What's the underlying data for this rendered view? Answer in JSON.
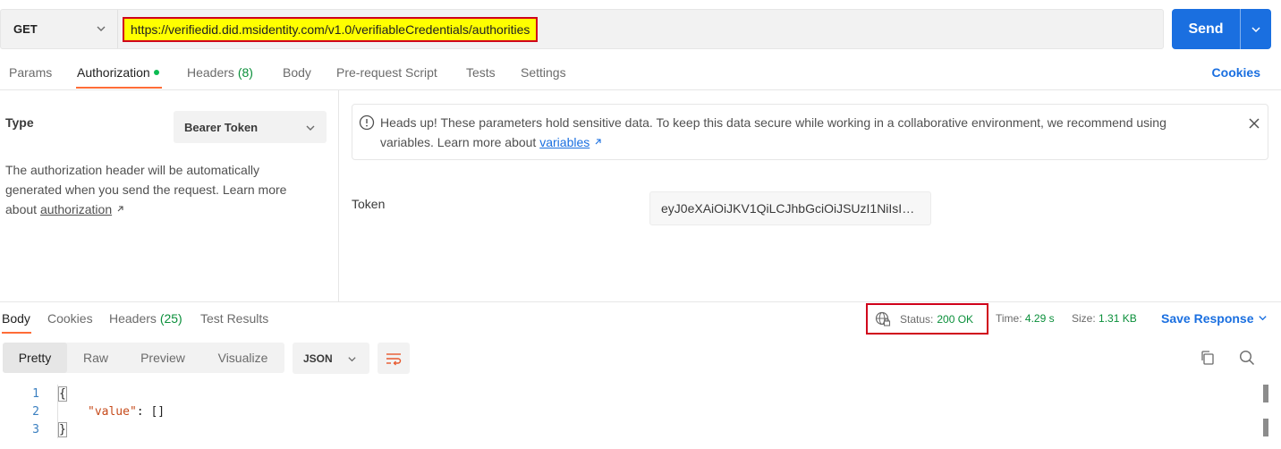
{
  "request": {
    "method": "GET",
    "url": "https://verifiedid.did.msidentity.com/v1.0/verifiableCredentials/authorities",
    "send_label": "Send"
  },
  "request_tabs": [
    {
      "label": "Params"
    },
    {
      "label": "Authorization"
    },
    {
      "label": "Headers",
      "count": "(8)"
    },
    {
      "label": "Body"
    },
    {
      "label": "Pre-request Script"
    },
    {
      "label": "Tests"
    },
    {
      "label": "Settings"
    }
  ],
  "cookies_link": "Cookies",
  "auth": {
    "type_label": "Type",
    "type_value": "Bearer Token",
    "description": "The authorization header will be automatically generated when you send the request. Learn more about",
    "description_link": "authorization",
    "notice_text": "Heads up! These parameters hold sensitive data. To keep this data secure while working in a collaborative environment, we recommend using variables. Learn more about",
    "notice_link": "variables",
    "token_label": "Token",
    "token_value": "eyJ0eXAiOiJKV1QiLCJhbGciOiJSUzI1NiIsIng..."
  },
  "response_tabs": [
    {
      "label": "Body"
    },
    {
      "label": "Cookies"
    },
    {
      "label": "Headers",
      "count": "(25)"
    },
    {
      "label": "Test Results"
    }
  ],
  "response_meta": {
    "status_label": "Status:",
    "status_value": "200 OK",
    "time_label": "Time:",
    "time_value": "4.29 s",
    "size_label": "Size:",
    "size_value": "1.31 KB",
    "save_response": "Save Response"
  },
  "view_modes": [
    "Pretty",
    "Raw",
    "Preview",
    "Visualize"
  ],
  "format": "JSON",
  "code": {
    "line_numbers": [
      "1",
      "2",
      "3"
    ],
    "line1": "{",
    "key": "\"value\"",
    "after_key": ": []",
    "line3": "}"
  },
  "colors": {
    "accent_blue": "#1a6fe0",
    "tab_orange": "#ff6c37",
    "status_green": "#0a8f3a",
    "highlight_yellow": "#ffff00",
    "highlight_red": "#d0021b"
  }
}
